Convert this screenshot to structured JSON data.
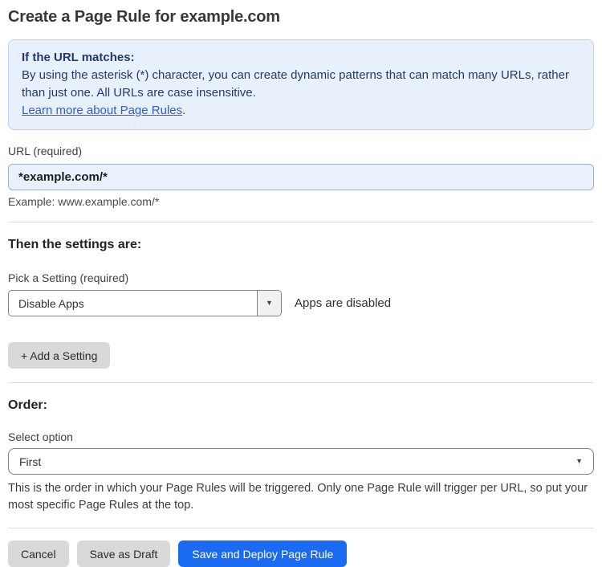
{
  "page": {
    "title": "Create a Page Rule for example.com"
  },
  "info_box": {
    "heading": "If the URL matches:",
    "body": "By using the asterisk (*) character, you can create dynamic patterns that can match many URLs, rather than just one. All URLs are case insensitive.",
    "link_label": "Learn more about Page Rules",
    "link_suffix": "."
  },
  "url_field": {
    "label": "URL (required)",
    "value": "*example.com/*",
    "helper": "Example: www.example.com/*"
  },
  "settings_section": {
    "heading": "Then the settings are:",
    "picker_label": "Pick a Setting (required)",
    "selected_setting": "Disable Apps",
    "status_text": "Apps are disabled",
    "add_setting_label": "+ Add a Setting"
  },
  "order_section": {
    "heading": "Order:",
    "select_label": "Select option",
    "selected_option": "First",
    "helper": "This is the order in which your Page Rules will be triggered. Only one Page Rule will trigger per URL, so put your most specific Page Rules at the top."
  },
  "actions": {
    "cancel_label": "Cancel",
    "save_draft_label": "Save as Draft",
    "save_deploy_label": "Save and Deploy Page Rule"
  },
  "icons": {
    "dropdown_caret": "▼"
  },
  "colors": {
    "accent_blue": "#1a6bf2",
    "info_box_bg": "#e8f1fb",
    "info_box_border": "#b7d3f0",
    "info_text_navy": "#23396e",
    "link_blue": "#2c5fd6",
    "input_bg": "#e9f1fc",
    "gray_button_bg": "#d9d9d9"
  }
}
